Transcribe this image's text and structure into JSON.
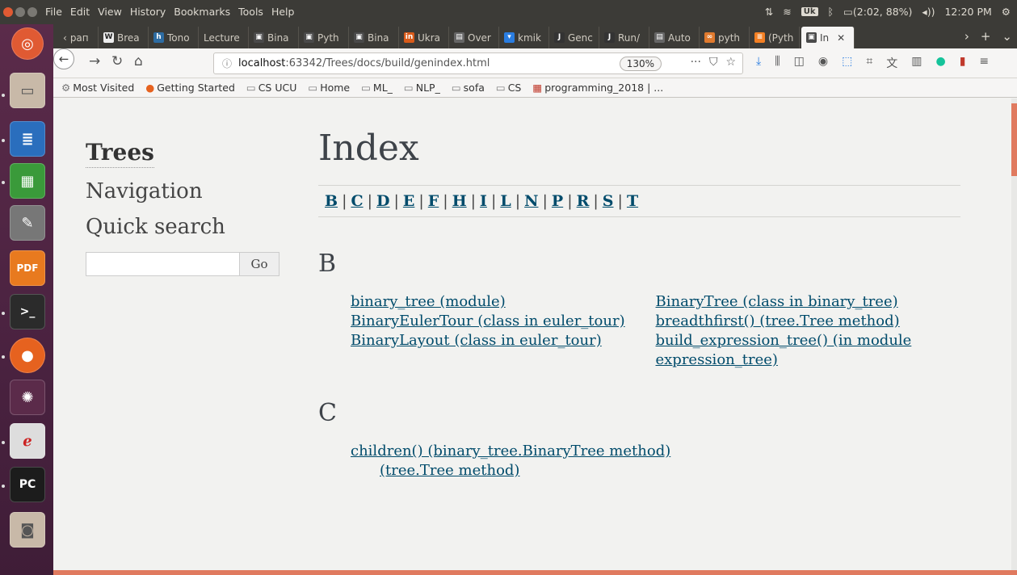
{
  "topbar": {
    "menus": [
      "File",
      "Edit",
      "View",
      "History",
      "Bookmarks",
      "Tools",
      "Help"
    ],
    "keyboard_layout": "Uk",
    "battery": "(2:02, 88%)",
    "clock": "12:20 PM"
  },
  "tabs": [
    {
      "label": "рап",
      "icon": "page-icon",
      "color": "#777"
    },
    {
      "label": "Brea",
      "icon": "wikipedia-icon",
      "color": "#eee"
    },
    {
      "label": "Tono",
      "icon": "h-icon",
      "color": "#2d6ca2"
    },
    {
      "label": "Lecture",
      "icon": "",
      "color": ""
    },
    {
      "label": "Bina",
      "icon": "pycharm-doc-icon",
      "color": "#4a4a4a"
    },
    {
      "label": "Pyth",
      "icon": "pycharm-doc-icon",
      "color": "#4a4a4a"
    },
    {
      "label": "Bina",
      "icon": "pycharm-doc-icon",
      "color": "#4a4a4a"
    },
    {
      "label": "Ukra",
      "icon": "in-icon",
      "color": "#d95b1a"
    },
    {
      "label": "Over",
      "icon": "grid-icon",
      "color": "#666"
    },
    {
      "label": "kmik",
      "icon": "k-icon",
      "color": "#2a7de1"
    },
    {
      "label": "Genc",
      "icon": "jb-icon",
      "color": "#333"
    },
    {
      "label": "Run/",
      "icon": "jb-icon",
      "color": "#333"
    },
    {
      "label": "Auto",
      "icon": "grid-icon",
      "color": "#666"
    },
    {
      "label": "pyth",
      "icon": "glasses-icon",
      "color": "#e07a2e"
    },
    {
      "label": "(Pyth",
      "icon": "stack-icon",
      "color": "#f48024"
    },
    {
      "label": "In",
      "icon": "pycharm-doc-icon",
      "color": "#4a4a4a",
      "active": true
    }
  ],
  "navbar": {
    "url_host": "localhost",
    "url_rest": ":63342/Trees/docs/build/genindex.html",
    "zoom": "130%"
  },
  "bookmarks": [
    {
      "label": "Most Visited",
      "icon": "gear-icon"
    },
    {
      "label": "Getting Started",
      "icon": "firefox-icon"
    },
    {
      "label": "CS UCU",
      "icon": "folder-icon"
    },
    {
      "label": "Home",
      "icon": "folder-icon"
    },
    {
      "label": "ML_",
      "icon": "folder-icon"
    },
    {
      "label": "NLP_",
      "icon": "folder-icon"
    },
    {
      "label": "sofa",
      "icon": "folder-icon"
    },
    {
      "label": "CS",
      "icon": "folder-icon"
    },
    {
      "label": "programming_2018 | ...",
      "icon": "slack-icon"
    }
  ],
  "sidebar": {
    "title": "Trees",
    "navigation": "Navigation",
    "quick_search": "Quick search",
    "go": "Go"
  },
  "main": {
    "title": "Index",
    "letters": [
      "B",
      "C",
      "D",
      "E",
      "F",
      "H",
      "I",
      "L",
      "N",
      "P",
      "R",
      "S",
      "T"
    ],
    "sections": [
      {
        "letter": "B",
        "col1": [
          "binary_tree (module)",
          "BinaryEulerTour (class in euler_tour)",
          "BinaryLayout (class in euler_tour)"
        ],
        "col2": [
          "BinaryTree (class in binary_tree)",
          "breadthfirst() (tree.Tree method)",
          "build_expression_tree() (in module expression_tree)"
        ]
      },
      {
        "letter": "C",
        "col1": [
          "children() (binary_tree.BinaryTree method)"
        ],
        "sub1": [
          "(tree.Tree method)"
        ]
      }
    ]
  },
  "colors": {
    "link": "#004b6b",
    "accent": "#e07a5f"
  }
}
